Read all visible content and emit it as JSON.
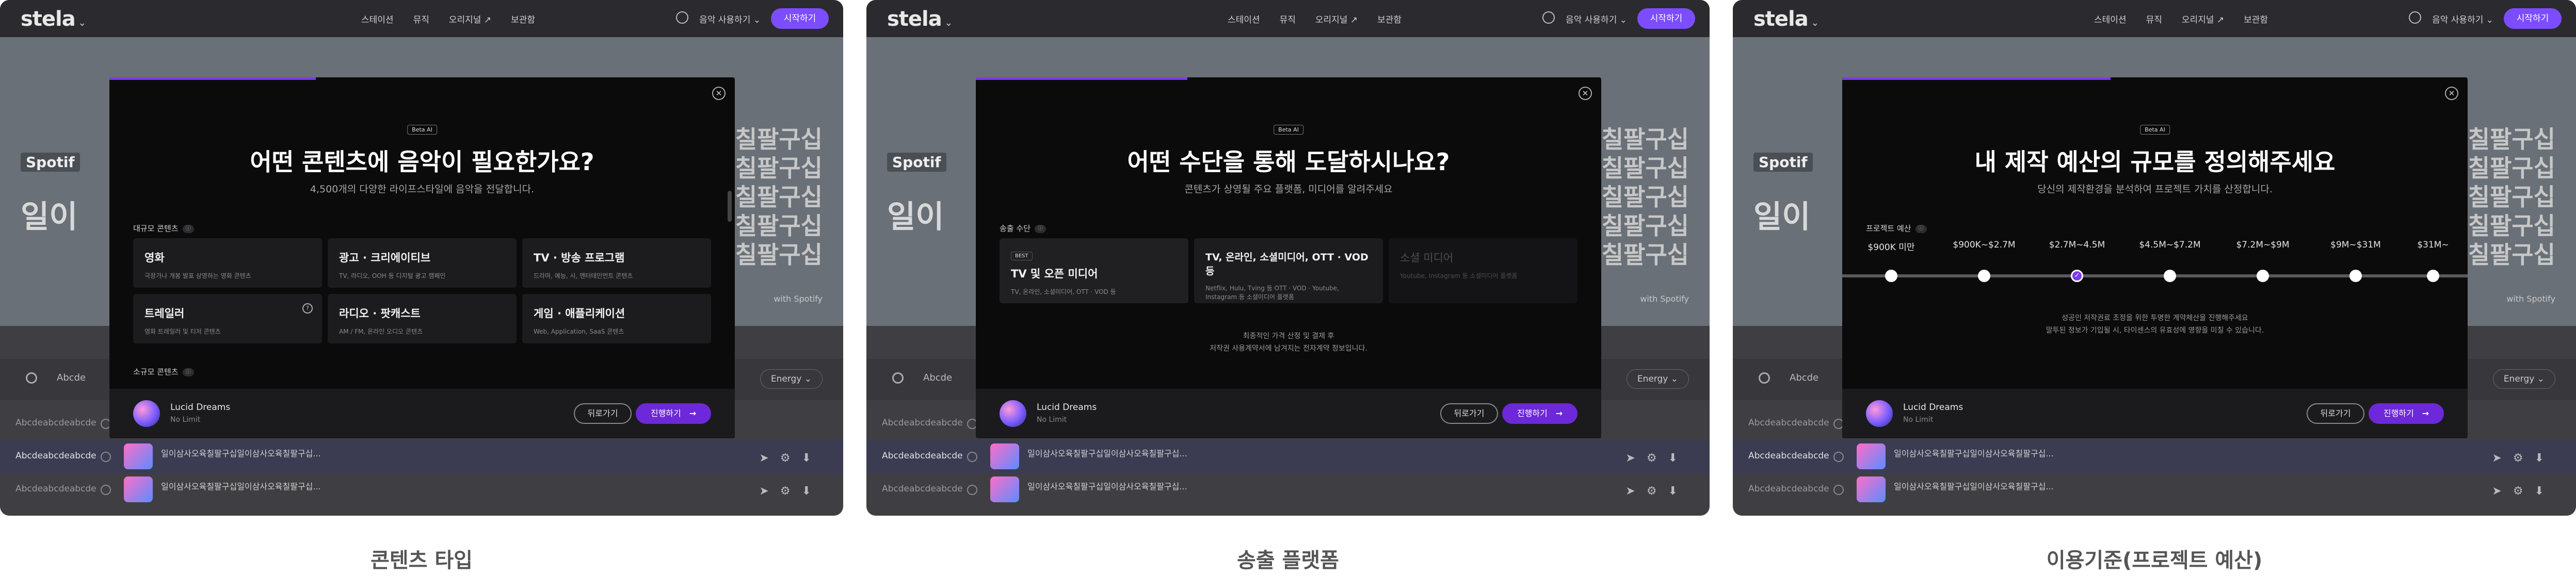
{
  "app": {
    "logo": "stela",
    "nav": [
      "스테이션",
      "뮤직",
      "오리지널 ↗",
      "보관함"
    ],
    "user_select": "음악 사용하기",
    "start": "시작하기"
  },
  "background": {
    "spotify_tag": "Spotif",
    "hero_left": "일이",
    "hero_right": [
      "오육칠팔구십",
      "오육칠팔구십",
      "오육칠팔구십",
      "오육칠팔구십",
      "오육칠팔구십"
    ],
    "hero_sub": "with Spotify",
    "filter_text": "Abcde",
    "chips": [
      "Energy"
    ],
    "rows": [
      {
        "name": "Abcdeabcdeabcde",
        "title": ""
      },
      {
        "name": "Abcdeabcdeabcde",
        "title": "일이삼사오육칠팔구십일이삼사오육칠팔구십..."
      },
      {
        "name": "Abcdeabcdeabcde",
        "title": "일이삼사오육칠팔구십일이삼사오육칠팔구십..."
      }
    ]
  },
  "panels": [
    {
      "caption": "콘텐츠 타입",
      "beta": "Beta AI",
      "title": "어떤 콘텐츠에 음악이 필요한가요?",
      "subtitle": "4,500개의 다양한 라이프스타일에 음악을 전달합니다.",
      "section1": "대규모 콘텐츠",
      "cards": [
        {
          "title": "영화",
          "desc": "극장가나 개봉 발표 상영하는 영화 콘텐츠"
        },
        {
          "title": "광고 · 크리에이티브",
          "desc": "TV, 라디오, OOH 등 디지털 광고 캠페인"
        },
        {
          "title": "TV · 방송 프로그램",
          "desc": "드라마, 예능, 시, 엔터테인먼트 콘텐츠"
        },
        {
          "title": "트레일러",
          "desc": "영화 트레일러 및 티저 콘텐츠"
        },
        {
          "title": "라디오 · 팟캐스트",
          "desc": "AM / FM, 온라인 오디오 콘텐츠"
        },
        {
          "title": "게임 · 애플리케이션",
          "desc": "Web, Application, SaaS 콘텐츠"
        }
      ],
      "section2": "소규모 콘텐츠",
      "footer_name": "Lucid Dreams",
      "footer_sub": "No Limit",
      "back": "뒤로가기",
      "next": "진행하기"
    },
    {
      "caption": "송출 플랫폼",
      "beta": "Beta AI",
      "title": "어떤 수단을 통해 도달하시나요?",
      "subtitle": "콘텐츠가 상영될 주요 플랫폼, 미디어를 알려주세요",
      "section1": "송출 수단",
      "best": "BEST",
      "cards": [
        {
          "title": "TV 및 오픈 미디어",
          "desc": "TV, 온라인, 소셜미디어, OTT · VOD 등"
        },
        {
          "title": "TV, 온라인, 소셜미디어, OTT · VOD 등",
          "desc": "Netflix, Hulu, Tving 등 OTT · VOD · Youtube, Instagram 등 소셜미디어 플랫폼"
        },
        {
          "title": "소셜 미디어",
          "desc": "Youtube, Instagram 등 소셜미디어 플랫폼"
        }
      ],
      "note": [
        "최종적인 가격 산정 및 결제 후",
        "저작권 사용계약서에 남겨지는 전자계약 정보입니다."
      ],
      "footer_name": "Lucid Dreams",
      "footer_sub": "No Limit",
      "back": "뒤로가기",
      "next": "진행하기"
    },
    {
      "caption": "이용기준(프로젝트 예산)",
      "beta": "Beta AI",
      "title": "내 제작 예산의 규모를 정의해주세요",
      "subtitle": "당신의 제작환경을 분석하여 프로젝트 가치를 산정합니다.",
      "section1": "프로젝트 예산",
      "ticks": [
        "$900K 미만",
        "$900K~$2.7M",
        "$2.7M~4.5M",
        "$4.5M~$7.2M",
        "$7.2M~$9M",
        "$9M~$31M",
        "$31M~"
      ],
      "selected_index": 2,
      "note": [
        "성공인 저작권료 조정을 위한 투명한 계약체산을 진행해주세요",
        "말투된 정보가 기입될 시, 타이센스의 유효성에 영향을 미칠 수 있습니다."
      ],
      "footer_name": "Lucid Dreams",
      "footer_sub": "No Limit",
      "back": "뒤로가기",
      "next": "진행하기"
    }
  ]
}
